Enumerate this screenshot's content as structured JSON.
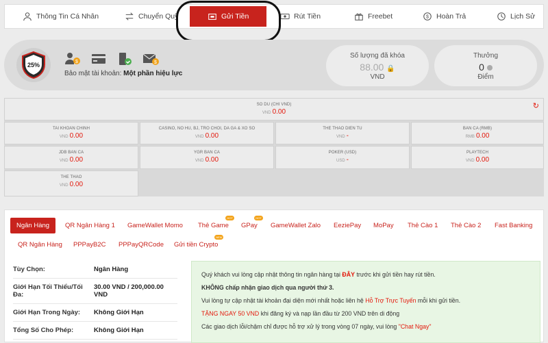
{
  "nav": {
    "items": [
      {
        "label": "Thông Tin Cá Nhân",
        "icon": "user-icon"
      },
      {
        "label": "Chuyển Quỹ",
        "icon": "transfer-icon"
      },
      {
        "label": "Gửi Tiền",
        "icon": "deposit-icon"
      },
      {
        "label": "Rút Tiền",
        "icon": "withdraw-icon"
      },
      {
        "label": "Freebet",
        "icon": "gift-icon"
      },
      {
        "label": "Hoàn Trả",
        "icon": "refund-icon"
      },
      {
        "label": "Lịch Sử",
        "icon": "history-icon"
      }
    ],
    "active": "Gửi Tiền"
  },
  "security": {
    "percent": "25%",
    "label": "Bảo mật tài khoản:",
    "status": "Một phần hiệu lực",
    "locked": {
      "title": "Số lượng đã khóa",
      "value": "88.00",
      "unit": "VND"
    },
    "reward": {
      "title": "Thưởng",
      "value": "0",
      "unit": "Điểm"
    }
  },
  "balance": {
    "main": {
      "label": "SO DU (CHI VND)",
      "currency": "VND",
      "value": "0.00"
    },
    "cells": [
      {
        "label": "TAI KHOAN CHINH",
        "currency": "VND",
        "value": "0.00"
      },
      {
        "label": "CASINO, NO HU, BJ, TRO CHOI, DA GA & XO SO",
        "currency": "VND",
        "value": "0.00"
      },
      {
        "label": "THE THAO DIEN TU",
        "currency": "VND",
        "value": "-"
      },
      {
        "label": "BAN CA (RMB)",
        "currency": "RMB",
        "value": "0.00"
      },
      {
        "label": "JDB BAN CA",
        "currency": "VND",
        "value": "0.00"
      },
      {
        "label": "YGR BAN CA",
        "currency": "VND",
        "value": "0.00"
      },
      {
        "label": "POKER (USD)",
        "currency": "USD",
        "value": "-"
      },
      {
        "label": "PLAYTECH",
        "currency": "VND",
        "value": "0.00"
      },
      {
        "label": "THE THAO",
        "currency": "VND",
        "value": "0.00"
      }
    ]
  },
  "deposit": {
    "tabs_row1": [
      "Ngân Hàng",
      "QR Ngân Hàng 1",
      "GameWallet Momo",
      "Thẻ Game",
      "GPay",
      "GameWallet Zalo",
      "EeziePay",
      "MoPay",
      "Thẻ Cào 1",
      "Thẻ Cào 2",
      "Fast Banking"
    ],
    "tabs_row2": [
      "QR Ngân Hàng",
      "PPPayB2C",
      "PPPayQRCode",
      "Gửi tiền Crypto"
    ],
    "badge_hot": "HOT",
    "badge_new": "NEW",
    "info": [
      {
        "key": "Tùy Chọn:",
        "value": "Ngân Hàng"
      },
      {
        "key": "Giới Hạn Tối Thiểu/Tối Đa:",
        "value": "30.00 VND / 200,000.00 VND"
      },
      {
        "key": "Giới Hạn Trong Ngày:",
        "value": "Không Giới Hạn"
      },
      {
        "key": "Tổng Số Cho Phép:",
        "value": "Không Giới Hạn"
      }
    ],
    "notice": {
      "line1_a": "Quý khách vui lòng cập nhật thông tin ngân hàng tại ",
      "line1_link": "ĐÂY",
      "line1_b": " trước khi gửi tiền hay rút tiền.",
      "line2": "KHÔNG chấp nhận giao dịch qua người thứ 3.",
      "line3_a": "Vui lòng tự cập nhật tài khoản đại diện mới nhất hoặc liên hệ ",
      "line3_link": "Hỗ Trợ Trực Tuyến",
      "line3_b": " mỗi khi gửi tiền.",
      "line4_red": "TẶNG NGAY 50 VND",
      "line4_b": " khi đăng ký và nạp lần đầu từ 200 VND trên di động",
      "line5_a": "Các giao dịch lỗi/chậm chỉ được hỗ trợ xử lý trong vòng 07 ngày, vui lòng ",
      "line5_link": "\"Chat Ngay\""
    }
  },
  "colors": {
    "brand_red": "#c8231d",
    "value_red": "#e3170a",
    "notice_bg": "#e8f6e4"
  }
}
